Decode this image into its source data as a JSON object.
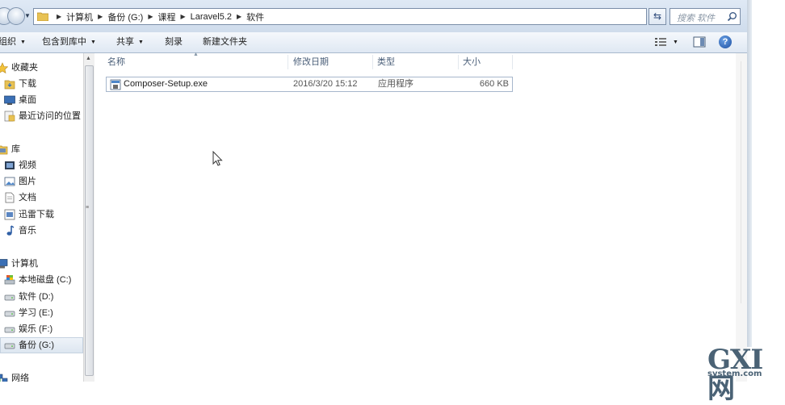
{
  "address_bar": {
    "breadcrumbs": [
      "计算机",
      "备份 (G:)",
      "课程",
      "Laravel5.2",
      "软件"
    ],
    "search_placeholder": "搜索 软件"
  },
  "toolbar": {
    "organize": "组织",
    "include_in_library": "包含到库中",
    "share": "共享",
    "burn": "刻录",
    "new_folder": "新建文件夹",
    "help": "?"
  },
  "nav_pane": {
    "favorites": {
      "label": "收藏夹",
      "items": [
        "下载",
        "桌面",
        "最近访问的位置"
      ]
    },
    "libraries": {
      "label": "库",
      "items": [
        "视频",
        "图片",
        "文档",
        "迅雷下载",
        "音乐"
      ]
    },
    "computer": {
      "label": "计算机",
      "items": [
        "本地磁盘 (C:)",
        "软件 (D:)",
        "学习 (E:)",
        "娱乐 (F:)",
        "备份 (G:)"
      ],
      "selected": "备份 (G:)"
    },
    "network": {
      "label": "网络"
    }
  },
  "columns": {
    "name": "名称",
    "date": "修改日期",
    "type": "类型",
    "size": "大小"
  },
  "files": [
    {
      "name": "Composer-Setup.exe",
      "date": "2016/3/20 15:12",
      "type": "应用程序",
      "size": "660 KB"
    }
  ],
  "watermark": {
    "main": "GXI网",
    "sub": "system.com"
  },
  "colors": {
    "selection_border": "#a7b7cc",
    "toolbar_bg": "#dfe8f3",
    "column_header_text": "#4c607a"
  }
}
